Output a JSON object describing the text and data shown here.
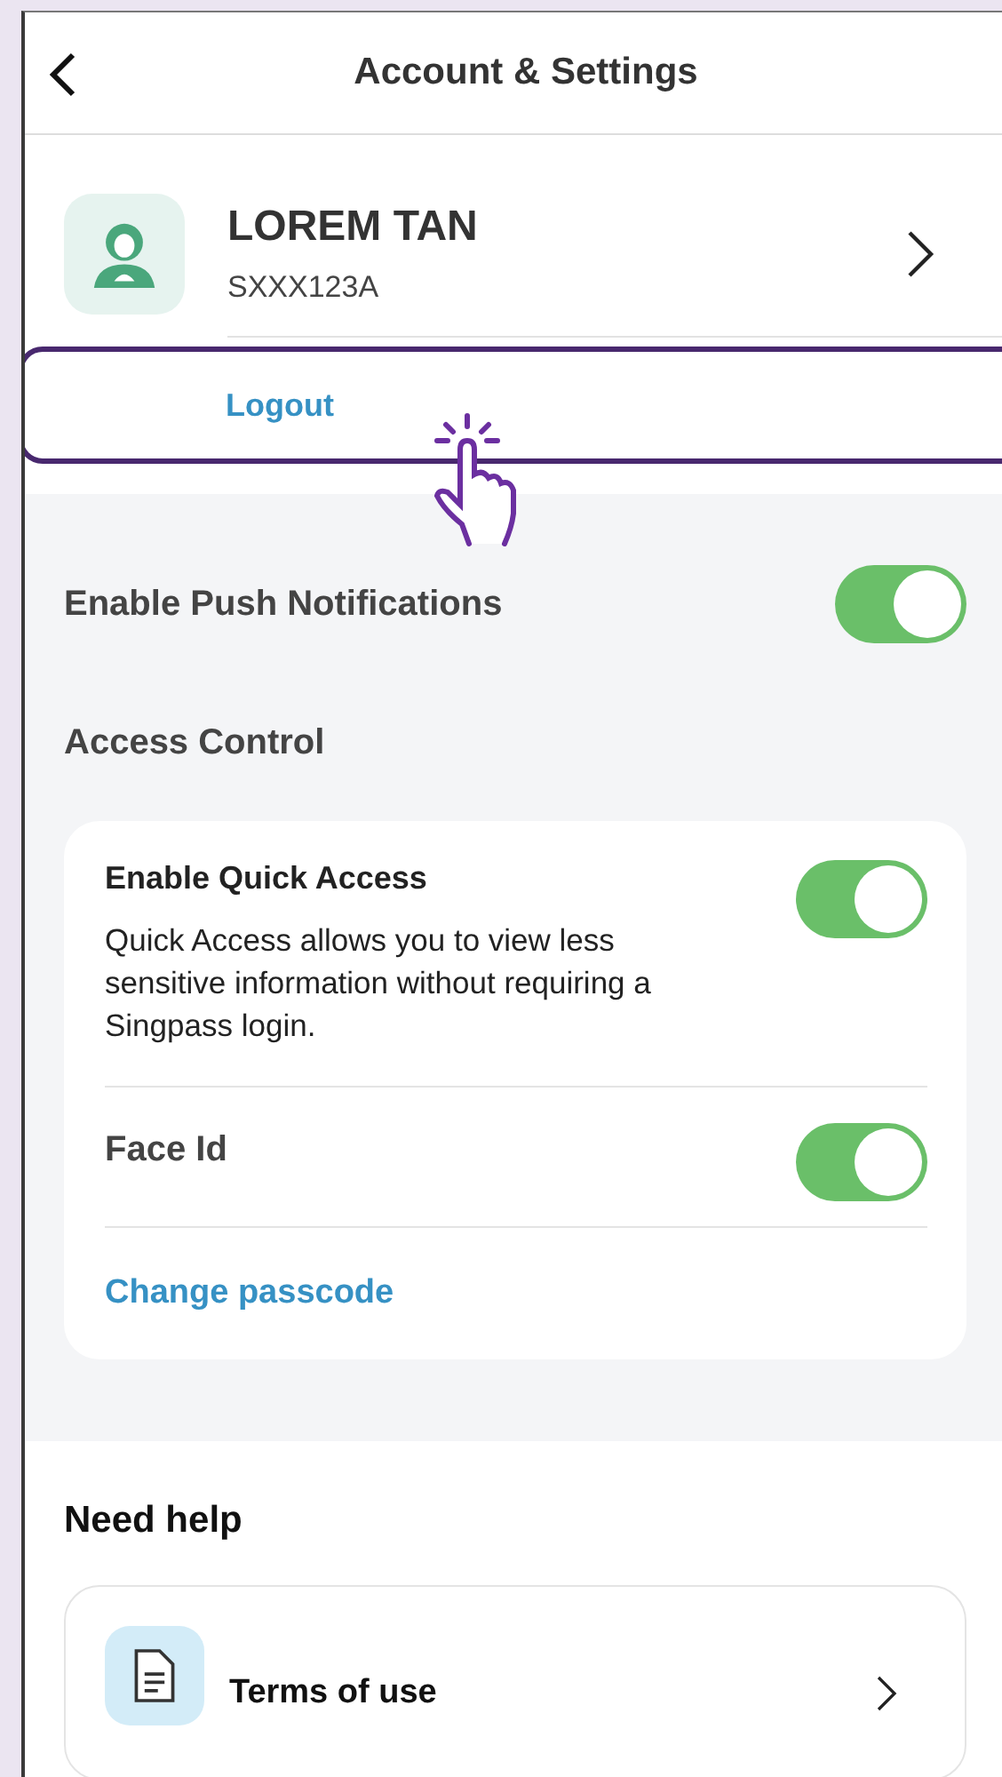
{
  "header": {
    "title": "Account & Settings"
  },
  "profile": {
    "name": "LOREM TAN",
    "id": "SXXX123A"
  },
  "logout": {
    "label": "Logout",
    "highlighted": true
  },
  "push_notifications": {
    "label": "Enable Push Notifications",
    "on": true
  },
  "access_control": {
    "title": "Access Control",
    "items": [
      {
        "kind": "toggle",
        "label": "Enable Quick Access",
        "description": "Quick Access allows you to view less sensitive information without requiring a Singpass login.",
        "on": true
      },
      {
        "kind": "toggle",
        "label": "Face Id",
        "on": true
      },
      {
        "kind": "link",
        "label": "Change passcode"
      }
    ]
  },
  "need_help": {
    "title": "Need help",
    "items": [
      {
        "label": "Terms of use"
      }
    ]
  }
}
